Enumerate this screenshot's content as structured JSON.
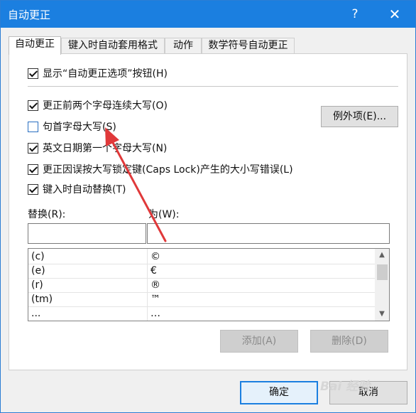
{
  "window": {
    "title": "自动更正",
    "help": "?",
    "close": "✕"
  },
  "tabs": [
    "自动更正",
    "键入时自动套用格式",
    "动作",
    "数学符号自动更正"
  ],
  "options": {
    "show_buttons": "显示“自动更正选项”按钮(H)",
    "two_initial_caps": "更正前两个字母连续大写(O)",
    "capitalize_first_letter": "句首字母大写(S)",
    "capitalize_day_names": "英文日期第一个字母大写(N)",
    "caps_lock_fix": "更正因误按大写锁定键(Caps Lock)产生的大小写错误(L)",
    "replace_as_you_type": "键入时自动替换(T)"
  },
  "buttons": {
    "exceptions": "例外项(E)...",
    "add": "添加(A)",
    "delete": "删除(D)",
    "ok": "确定",
    "cancel": "取消"
  },
  "replace": {
    "replace_label": "替换(R):",
    "with_label": "为(W):",
    "replace_value": "",
    "with_value": ""
  },
  "list": [
    {
      "from": "(c)",
      "to": "©"
    },
    {
      "from": "(e)",
      "to": "€"
    },
    {
      "from": "(r)",
      "to": "®"
    },
    {
      "from": "(tm)",
      "to": "™"
    },
    {
      "from": "...",
      "to": "…"
    }
  ],
  "scroll": {
    "up": "▲",
    "down": "▼"
  },
  "watermark": "Bai 经验",
  "colors": {
    "titlebar": "#1b7fe0",
    "annotation_arrow": "#e0393a"
  }
}
